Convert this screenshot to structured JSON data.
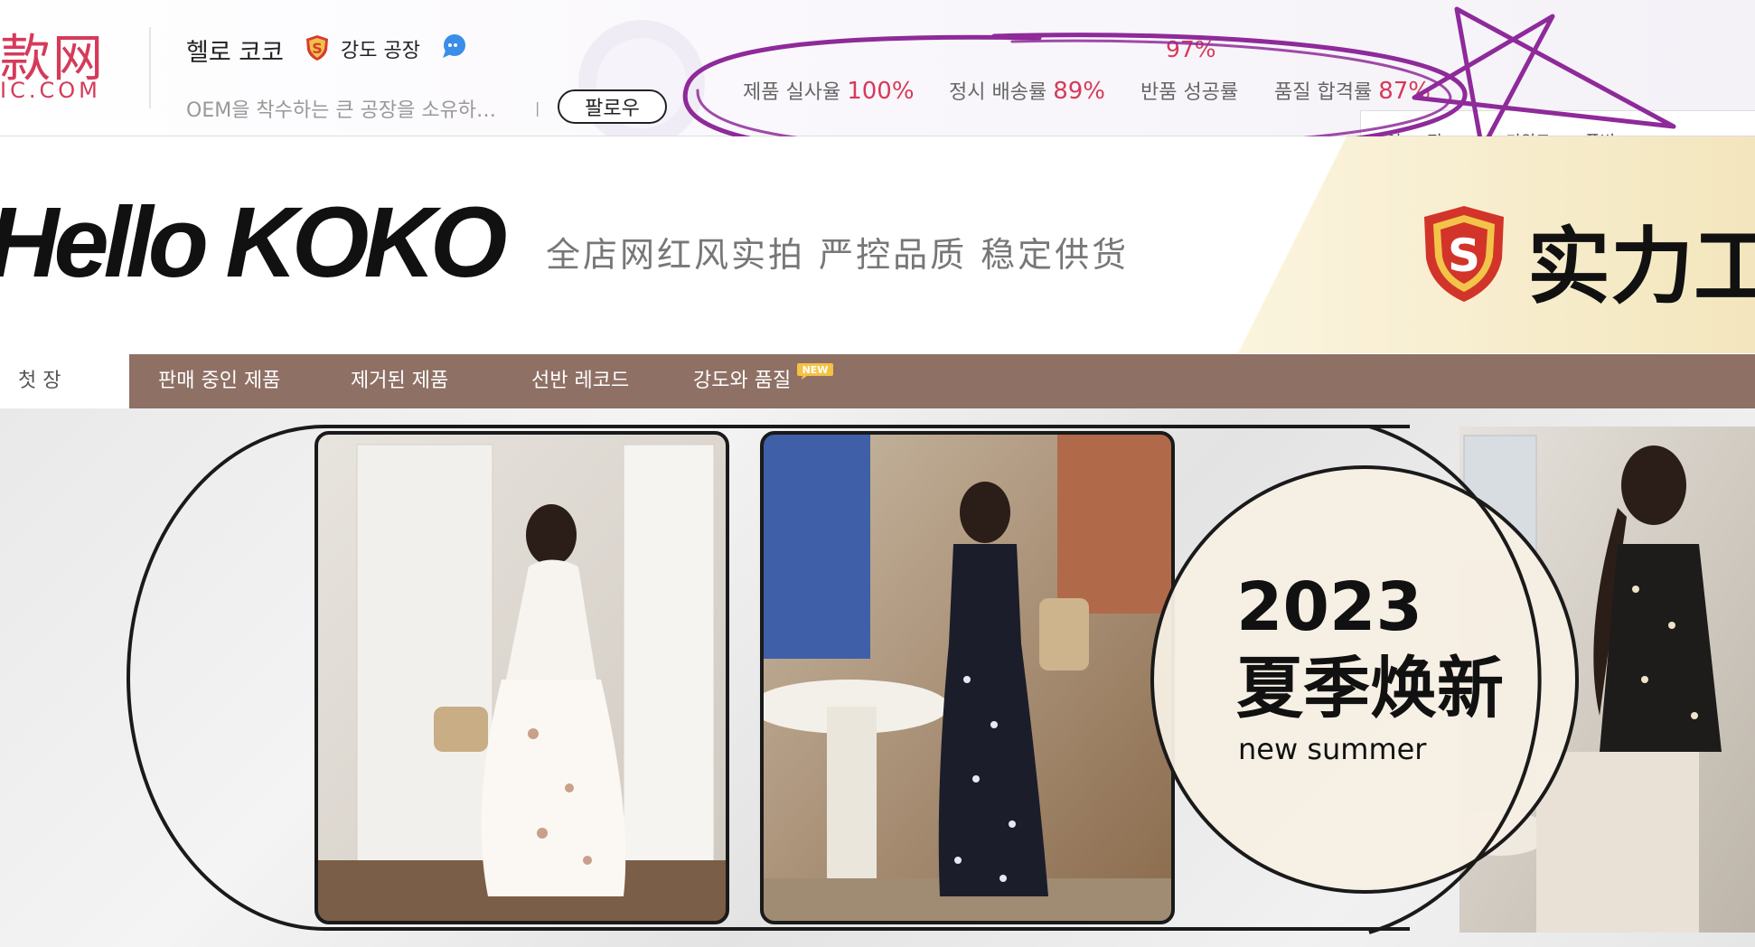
{
  "header": {
    "logo_cn": "款网",
    "logo_domain": "IC.COM",
    "shop_name": "헬로 코코",
    "badge_label": "강도 공장",
    "description": "OEM을 착수하는 큰 공장을 소유하…",
    "separator": "|",
    "follow_label": "팔로우",
    "stats_top_value": "97%",
    "stats": [
      {
        "label": "제품 실사율",
        "value": "100%"
      },
      {
        "label": "정시 배송률",
        "value": "89%"
      },
      {
        "label": "반품 성공률",
        "value": ""
      },
      {
        "label": "품질 합격률",
        "value": "87%"
      }
    ],
    "fragment_labels": [
      "이 ... 정",
      "키워드",
      "품번"
    ]
  },
  "banner": {
    "brand": "Hello KOKO",
    "tagline": "全店网红风实拍  严控品质  稳定供货",
    "badge_text": "实力工"
  },
  "nav": {
    "items": [
      "첫 장",
      "판매 중인 제품",
      "제거된 제품",
      "선반 레코드",
      "강도와 품질"
    ],
    "new_tag": "NEW"
  },
  "hero": {
    "promo_year": "2023",
    "promo_title": "夏季焕新",
    "promo_sub": "new summer"
  },
  "colors": {
    "accent": "#d63a5a",
    "nav_bg": "#8f7065",
    "annotation": "#8e2a9a",
    "gold": "#f6eed3"
  }
}
